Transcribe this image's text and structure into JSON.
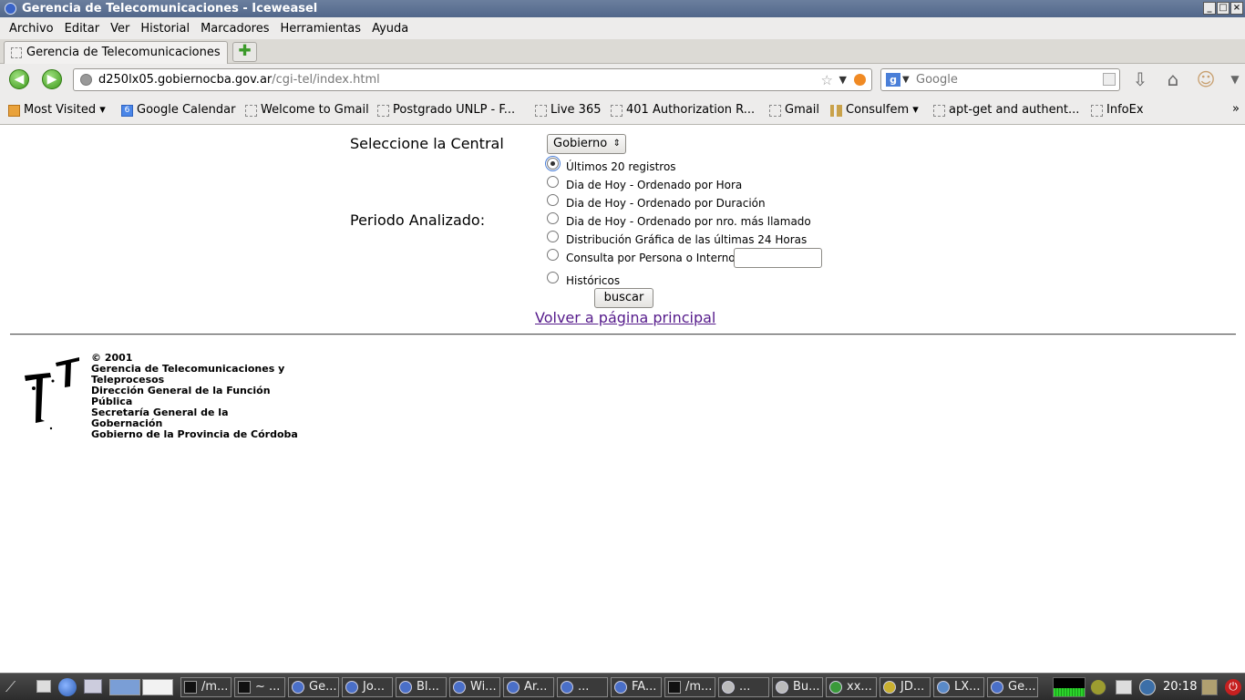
{
  "window": {
    "title": "Gerencia de Telecomunicaciones - Iceweasel"
  },
  "menubar": {
    "items": [
      "Archivo",
      "Editar",
      "Ver",
      "Historial",
      "Marcadores",
      "Herramientas",
      "Ayuda"
    ]
  },
  "tabs": [
    {
      "label": "Gerencia de Telecomunicaciones"
    }
  ],
  "navbar": {
    "url_host": "d250lx05.gobiernocba.gov.ar",
    "url_path": "/cgi-tel/index.html",
    "search_placeholder": "Google"
  },
  "bookmarks": [
    {
      "label": "Most Visited",
      "icon": "most-visited-icon"
    },
    {
      "label": "Google Calendar",
      "icon": "calendar-icon"
    },
    {
      "label": "Welcome to Gmail",
      "icon": "page-icon"
    },
    {
      "label": "Postgrado UNLP - F...",
      "icon": "page-icon"
    },
    {
      "label": "Live 365",
      "icon": "page-icon"
    },
    {
      "label": "401 Authorization R...",
      "icon": "page-icon"
    },
    {
      "label": "Gmail",
      "icon": "page-icon"
    },
    {
      "label": "Consulfem",
      "icon": "folder-icon"
    },
    {
      "label": "apt-get and authent...",
      "icon": "page-icon"
    },
    {
      "label": "InfoEx",
      "icon": "page-icon"
    }
  ],
  "page": {
    "central_label": "Seleccione la Central",
    "central_value": "Gobierno",
    "periodo_label": "Periodo Analizado:",
    "options": [
      {
        "label": "Últimos 20 registros",
        "selected": true
      },
      {
        "label": "Dia de Hoy - Ordenado por Hora",
        "selected": false
      },
      {
        "label": "Dia de Hoy - Ordenado por Duración",
        "selected": false
      },
      {
        "label": "Dia de Hoy - Ordenado por nro. más llamado",
        "selected": false
      },
      {
        "label": "Distribución Gráfica de las últimas 24 Horas",
        "selected": false
      },
      {
        "label": "Consulta por Persona o Interno",
        "selected": false
      },
      {
        "label": "Históricos",
        "selected": false
      }
    ],
    "search_button": "buscar",
    "back_link": "Volver a página principal",
    "footer": [
      "© 2001",
      "Gerencia de Telecomunicaciones y Teleprocesos",
      "Dirección General de la Función Pública",
      "Secretaría General de la Gobernación",
      "Gobierno de la Provincia de Córdoba"
    ]
  },
  "taskbar": {
    "tasks": [
      "/m...",
      "~ ...",
      "Ge...",
      "Jo...",
      "Bl...",
      "Wi...",
      "Ar...",
      "...",
      "FA...",
      "/m...",
      "...",
      "Bu...",
      "xx...",
      "JD...",
      "LX...",
      "Ge..."
    ],
    "clock": "20:18"
  }
}
